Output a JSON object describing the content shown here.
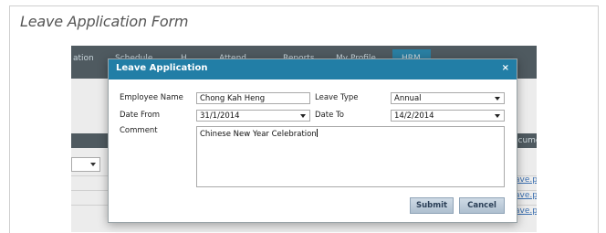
{
  "caption": "Leave Application Form",
  "background": {
    "nav_items": [
      "ation",
      "Schedule",
      "H",
      "Attend",
      "Reports",
      "My Profile",
      "HRM"
    ],
    "documents_header": "ocumer",
    "links": [
      "ave.pd",
      "ave.pd",
      "ave.pd"
    ]
  },
  "dialog": {
    "title": "Leave Application",
    "close": "×",
    "employee_name_label": "Employee Name",
    "employee_name_value": "Chong Kah Heng",
    "leave_type_label": "Leave Type",
    "leave_type_value": "Annual",
    "date_from_label": "Date From",
    "date_from_value": "31/1/2014",
    "date_to_label": "Date To",
    "date_to_value": "14/2/2014",
    "comment_label": "Comment",
    "comment_value": "Chinese New Year Celebration",
    "submit_label": "Submit",
    "cancel_label": "Cancel"
  },
  "colors": {
    "dialog_header": "#227ea6",
    "button": "#aebfcf"
  }
}
